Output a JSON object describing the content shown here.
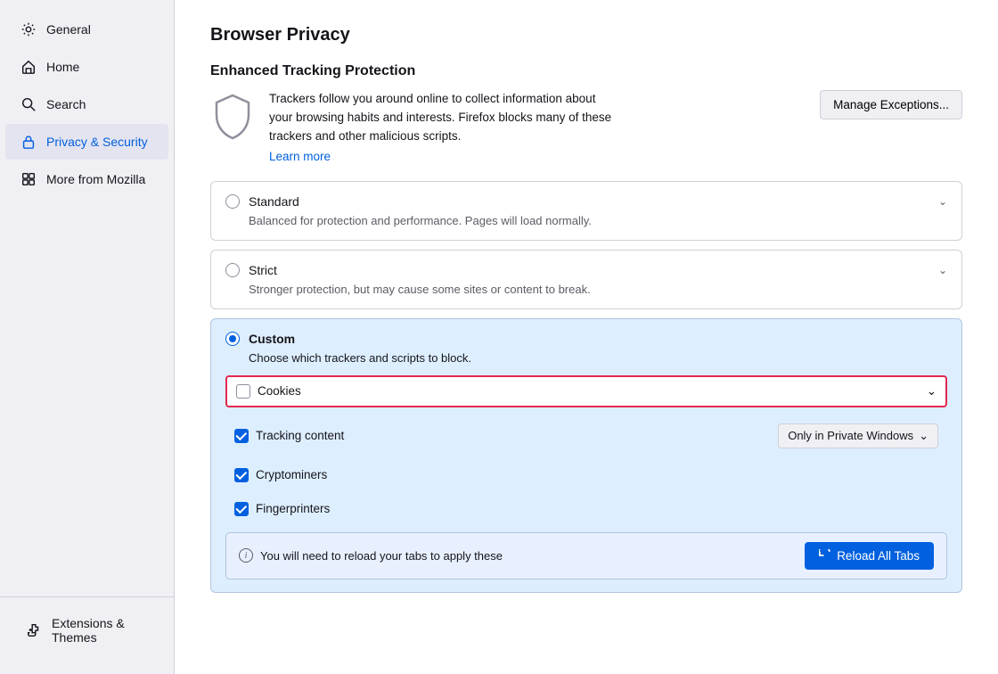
{
  "sidebar": {
    "items": [
      {
        "id": "general",
        "label": "General",
        "icon": "gear"
      },
      {
        "id": "home",
        "label": "Home",
        "icon": "home"
      },
      {
        "id": "search",
        "label": "Search",
        "icon": "search"
      },
      {
        "id": "privacy",
        "label": "Privacy & Security",
        "icon": "lock",
        "active": true
      },
      {
        "id": "mozilla",
        "label": "More from Mozilla",
        "icon": "mozilla"
      }
    ],
    "bottom_item": {
      "id": "extensions",
      "label": "Extensions & Themes",
      "icon": "puzzle"
    }
  },
  "main": {
    "page_title": "Browser Privacy",
    "etp": {
      "section_title": "Enhanced Tracking Protection",
      "description": "Trackers follow you around online to collect information about your browsing habits and interests. Firefox blocks many of these trackers and other malicious scripts.",
      "learn_more": "Learn more",
      "manage_btn": "Manage Exceptions..."
    },
    "options": [
      {
        "id": "standard",
        "label": "Standard",
        "desc": "Balanced for protection and performance. Pages will load normally.",
        "selected": false
      },
      {
        "id": "strict",
        "label": "Strict",
        "desc": "Stronger protection, but may cause some sites or content to break.",
        "selected": false
      }
    ],
    "custom": {
      "label": "Custom",
      "desc": "Choose which trackers and scripts to block.",
      "selected": true,
      "cookies": {
        "label": "Cookies",
        "checked": false
      },
      "tracking_content": {
        "label": "Tracking content",
        "checked": true,
        "dropdown_label": "Only in Private Windows"
      },
      "cryptominers": {
        "label": "Cryptominers",
        "checked": true
      },
      "fingerprinters": {
        "label": "Fingerprinters",
        "checked": true
      }
    },
    "reload_bar": {
      "text": "You will need to reload your tabs to apply these",
      "btn_label": "Reload All Tabs"
    }
  }
}
